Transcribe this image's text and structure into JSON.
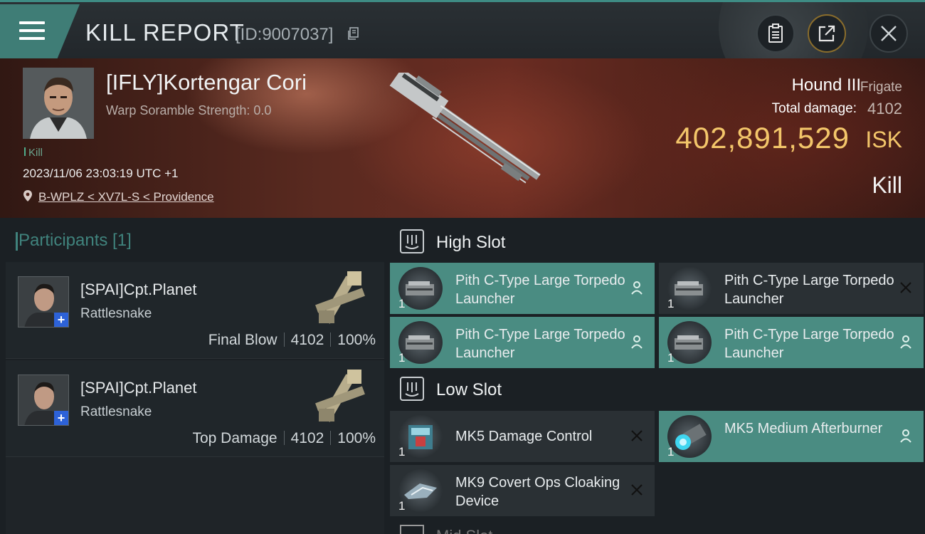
{
  "header": {
    "title": "KILL REPORT",
    "report_id": "[ID:9007037]",
    "icons": [
      "menu-icon",
      "copy-icon",
      "clipboard-icon",
      "share-icon",
      "close-icon"
    ]
  },
  "victim": {
    "pilot": "[IFLY]Kortengar Cori",
    "warp_scramble": "Warp Soramble Strength: 0.0",
    "kill_tag": "Kill",
    "datetime": "2023/11/06 23:03:19 UTC +1",
    "location": "B-WPLZ < XV7L-S < Providence",
    "ship_name": "Hound III",
    "ship_class": "Frigate",
    "total_damage_label": "Total damage:",
    "total_damage": "4102",
    "isk_value": "402,891,529",
    "isk_unit": "ISK",
    "result": "Kill"
  },
  "participants": {
    "heading": "Participants [1]",
    "rows": [
      {
        "name": "[SPAI]Cpt.Planet",
        "ship": "Rattlesnake",
        "role": "Final Blow",
        "damage": "4102",
        "percent": "100%"
      },
      {
        "name": "[SPAI]Cpt.Planet",
        "ship": "Rattlesnake",
        "role": "Top Damage",
        "damage": "4102",
        "percent": "100%"
      }
    ]
  },
  "slots": {
    "high": {
      "label": "High Slot",
      "modules": [
        {
          "name": "Pith C-Type Large Torpedo Launcher",
          "qty": "1",
          "status": "dropped"
        },
        {
          "name": "Pith C-Type Large Torpedo Launcher",
          "qty": "1",
          "status": "destroyed"
        },
        {
          "name": "Pith C-Type Large Torpedo Launcher",
          "qty": "1",
          "status": "dropped"
        },
        {
          "name": "Pith C-Type Large Torpedo Launcher",
          "qty": "1",
          "status": "dropped"
        }
      ]
    },
    "low": {
      "label": "Low Slot",
      "modules": [
        {
          "name": "MK5 Damage Control",
          "qty": "1",
          "status": "destroyed"
        },
        {
          "name": "MK5 Medium Afterburner",
          "qty": "1",
          "status": "dropped"
        },
        {
          "name": "MK9 Covert Ops Cloaking Device",
          "qty": "1",
          "status": "destroyed"
        }
      ]
    },
    "next_partial_label": "Mid Slot"
  },
  "colors": {
    "accent_teal": "#4a8c82",
    "isk_gold": "#f3c66a",
    "panel_dark": "#2a3034"
  }
}
